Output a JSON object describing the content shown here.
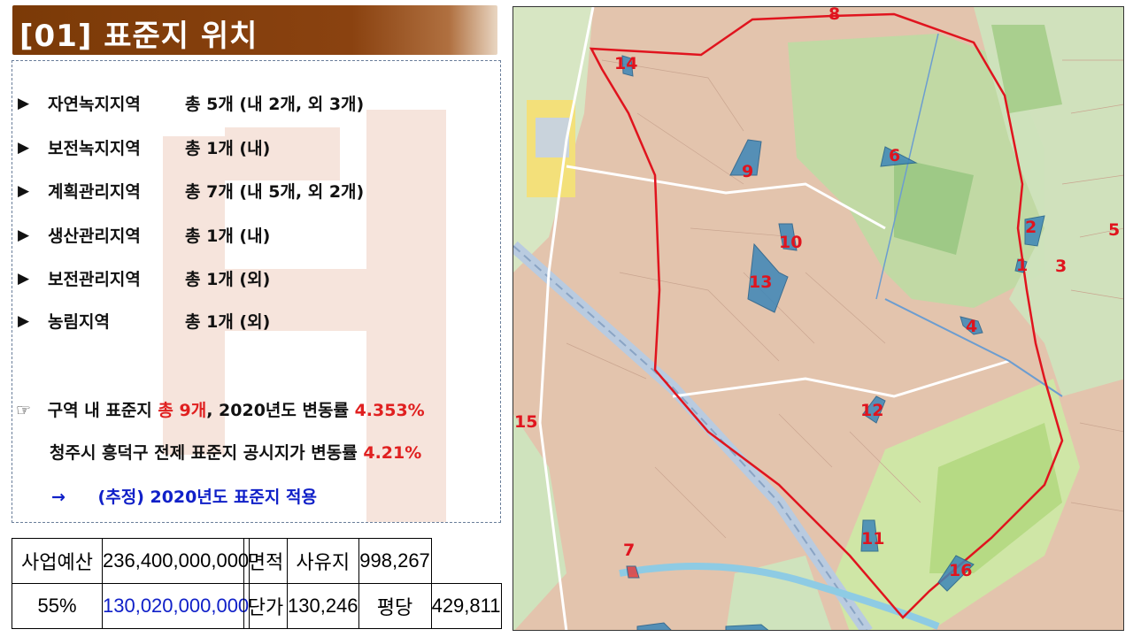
{
  "title": "[01] 표준지 위치",
  "zones": [
    {
      "bullet": "▶",
      "name": "자연녹지지역",
      "count": "총 5개 (내 2개, 외 3개)"
    },
    {
      "bullet": "▶",
      "name": "보전녹지지역",
      "count": "총 1개 (내)"
    },
    {
      "bullet": "▶",
      "name": "계획관리지역",
      "count": "총 7개 (내 5개, 외 2개)"
    },
    {
      "bullet": "▶",
      "name": "생산관리지역",
      "count": "총 1개 (내)"
    },
    {
      "bullet": "▶",
      "name": "보전관리지역",
      "count": "총 1개 (외)"
    },
    {
      "bullet": "▶",
      "name": "농림지역",
      "count": "총 1개 (외)"
    }
  ],
  "note": {
    "icon": "☞",
    "line1_a": "구역 내 표준지",
    "line1_b": "총 9개",
    "line1_c": ", 2020년도  변동률",
    "line1_d": "4.353%",
    "line2_a": "청주시 흥덕구 전제 표준지 공시지가 변동률",
    "line2_b": "4.21%",
    "line3_arrow": "→",
    "line3_text": "(추정) 2020년도  표준지 적용"
  },
  "budget": {
    "label1": "사업예산",
    "value1": "236,400,000,000",
    "label2": "55%",
    "value2": "130,020,000,000"
  },
  "unit": {
    "area_label": "면적",
    "private_label": "사유지",
    "private_value": "998,267",
    "price_label": "단가",
    "price_value": "130,246",
    "pyeong_label": "평당",
    "pyeong_value": "429,811"
  },
  "map_labels": [
    "1",
    "2",
    "3",
    "4",
    "5",
    "6",
    "7",
    "8",
    "9",
    "10",
    "11",
    "12",
    "13",
    "14",
    "15",
    "16"
  ],
  "colors": {
    "title_bg": "#8a4210",
    "boundary": "#e0141e",
    "parcel": "#3d86b8",
    "highlight_red": "#e02020",
    "highlight_blue": "#1020c8"
  }
}
